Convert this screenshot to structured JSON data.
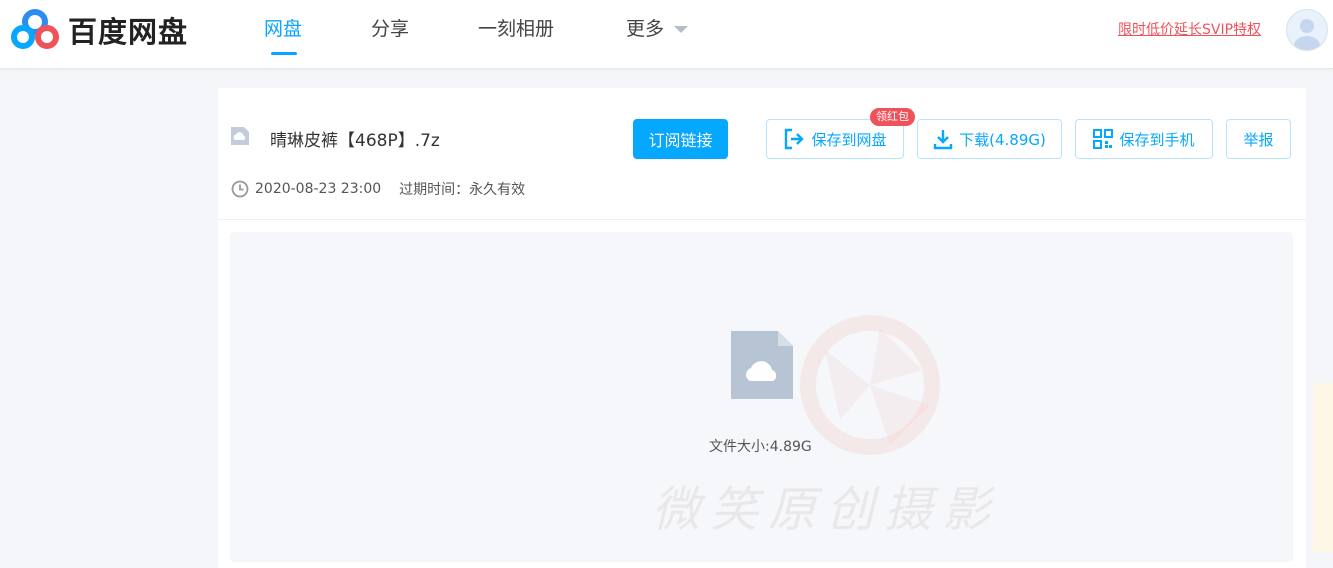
{
  "header": {
    "brand": "百度网盘",
    "nav": [
      "网盘",
      "分享",
      "一刻相册",
      "更多"
    ],
    "promo": "限时低价延长SVIP特权"
  },
  "file": {
    "title": "晴琳皮裤【468P】.7z",
    "date": "2020-08-23 23:00",
    "expire_label": "过期时间：永久有效",
    "size_label": "文件大小:4.89G"
  },
  "actions": {
    "subscribe": "订阅链接",
    "save_disk": "保存到网盘",
    "badge": "领红包",
    "download": "下载(4.89G)",
    "save_phone": "保存到手机",
    "report": "举报"
  },
  "watermark": {
    "text": "微笑原创摄影"
  },
  "colors": {
    "accent": "#06a7ff",
    "promo": "#f0525a"
  },
  "icons": [
    "baidu-logo-icon",
    "file-icon",
    "clock-icon",
    "save-icon",
    "download-icon",
    "qrcode-icon",
    "cloud-file-icon",
    "avatar-icon",
    "chevron-down-icon"
  ]
}
